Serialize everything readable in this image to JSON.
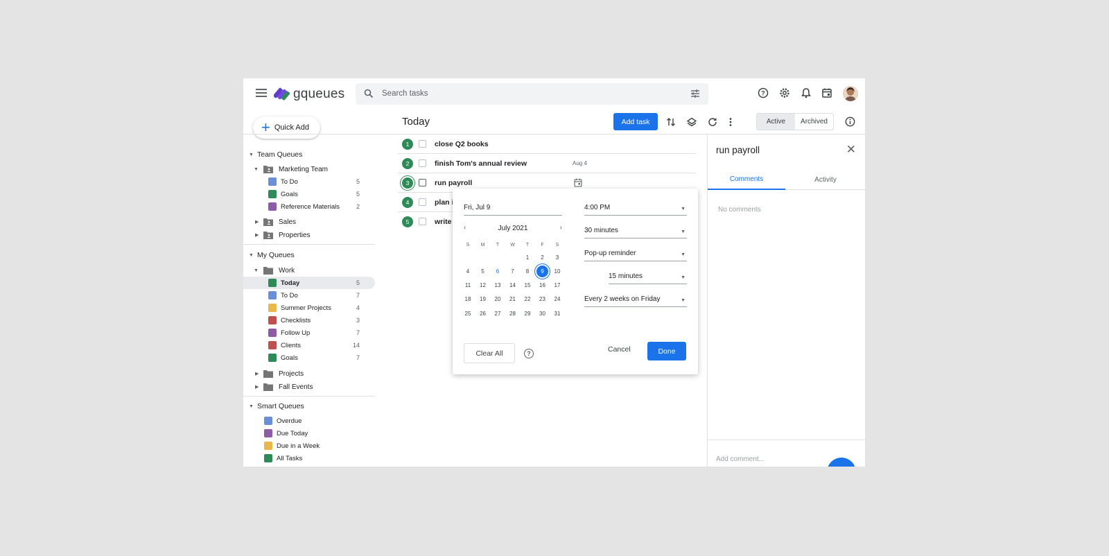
{
  "app": {
    "logo_text": "gqueues"
  },
  "search": {
    "placeholder": "Search tasks"
  },
  "header_icons": [
    "help-icon",
    "settings-icon",
    "notifications-icon",
    "calendar-icon"
  ],
  "sidebar": {
    "quick_add": "Quick Add",
    "team_queues": {
      "label": "Team Queues",
      "groups": [
        {
          "label": "Marketing Team",
          "expanded": true,
          "items": [
            {
              "label": "To Do",
              "count": "5",
              "color": "#6b8fd6"
            },
            {
              "label": "Goals",
              "count": "5",
              "color": "#2e8b57"
            },
            {
              "label": "Reference Materials",
              "count": "2",
              "color": "#8e5ba6"
            }
          ]
        },
        {
          "label": "Sales",
          "expanded": false
        },
        {
          "label": "Properties",
          "expanded": false
        }
      ]
    },
    "my_queues": {
      "label": "My Queues",
      "groups": [
        {
          "label": "Work",
          "expanded": true,
          "items": [
            {
              "label": "Today",
              "count": "5",
              "color": "#2e8b57",
              "selected": true
            },
            {
              "label": "To Do",
              "count": "7",
              "color": "#6b8fd6"
            },
            {
              "label": "Summer Projects",
              "count": "4",
              "color": "#e8b84a"
            },
            {
              "label": "Checklists",
              "count": "3",
              "color": "#c0504d"
            },
            {
              "label": "Follow Up",
              "count": "7",
              "color": "#8e5ba6"
            },
            {
              "label": "Clients",
              "count": "14",
              "color": "#c0504d"
            },
            {
              "label": "Goals",
              "count": "7",
              "color": "#2e8b57"
            }
          ]
        },
        {
          "label": "Projects",
          "expanded": false
        },
        {
          "label": "Fall Events",
          "expanded": false
        }
      ]
    },
    "smart_queues": {
      "label": "Smart Queues",
      "items": [
        {
          "label": "Overdue",
          "color": "#6b8fd6"
        },
        {
          "label": "Due Today",
          "color": "#8e5ba6"
        },
        {
          "label": "Due in a Week",
          "color": "#e8b84a"
        },
        {
          "label": "All Tasks",
          "color": "#2e8b57"
        }
      ]
    }
  },
  "main": {
    "title": "Today",
    "add_task": "Add task",
    "tabs": {
      "active": "Active",
      "archived": "Archived"
    },
    "tasks": [
      {
        "num": "1",
        "title": "close Q2 books",
        "due": ""
      },
      {
        "num": "2",
        "title": "finish Tom's annual review",
        "due": "Aug 4"
      },
      {
        "num": "3",
        "title": "run payroll",
        "due": ""
      },
      {
        "num": "4",
        "title": "plan i",
        "due": ""
      },
      {
        "num": "5",
        "title": "write",
        "due": ""
      }
    ]
  },
  "date_popup": {
    "date_value": "Fri, Jul 9",
    "month_label": "July 2021",
    "weekdays": [
      "S",
      "M",
      "T",
      "W",
      "T",
      "F",
      "S"
    ],
    "weeks": [
      [
        "",
        "",
        "",
        "",
        "1",
        "2",
        "3"
      ],
      [
        "4",
        "5",
        "6",
        "7",
        "8",
        "9",
        "10"
      ],
      [
        "11",
        "12",
        "13",
        "14",
        "15",
        "16",
        "17"
      ],
      [
        "18",
        "19",
        "20",
        "21",
        "22",
        "23",
        "24"
      ],
      [
        "25",
        "26",
        "27",
        "28",
        "29",
        "30",
        "31"
      ]
    ],
    "today_day": "6",
    "selected_day": "9",
    "time": "4:00 PM",
    "duration": "30 minutes",
    "reminder_type": "Pop-up reminder",
    "reminder_offset": "15 minutes",
    "repeat": "Every 2 weeks on Friday",
    "clear_all": "Clear All",
    "cancel": "Cancel",
    "done": "Done"
  },
  "detail_panel": {
    "title": "run payroll",
    "tabs": [
      "Comments",
      "Activity"
    ],
    "empty_text": "No comments",
    "comment_placeholder": "Add comment..."
  },
  "colors": {
    "accent": "#1a73e8",
    "task_badge": "#2e8b57"
  }
}
